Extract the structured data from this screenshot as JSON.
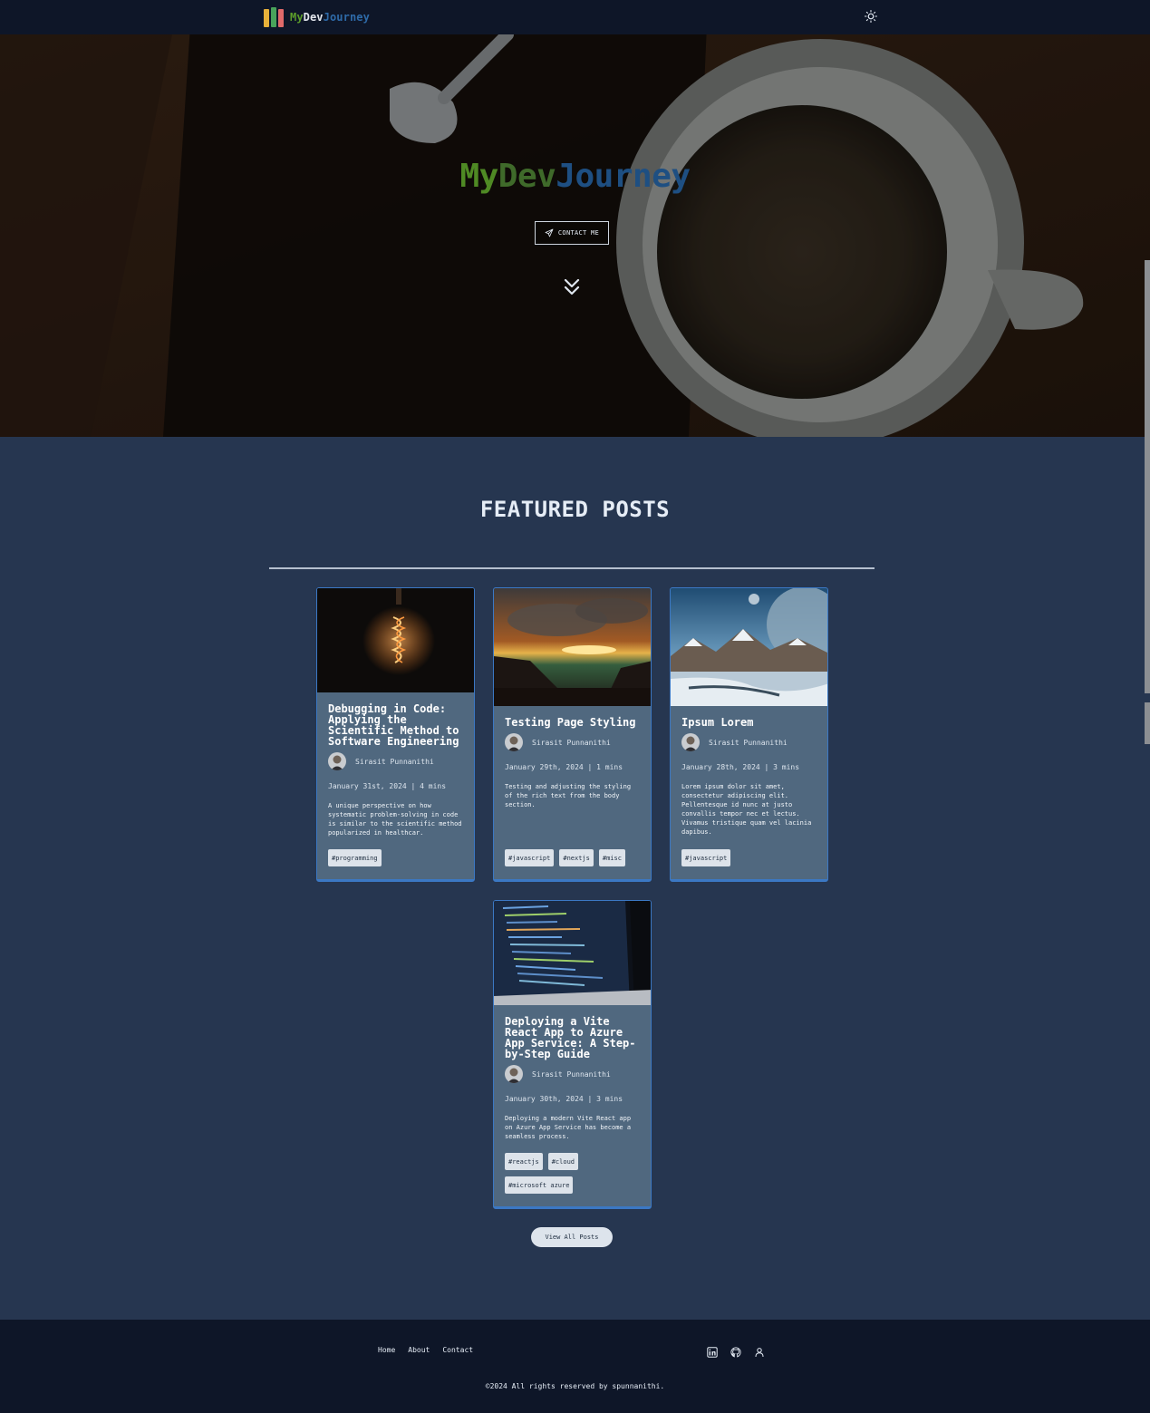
{
  "navbar": {
    "logo": {
      "part1": "My",
      "part2": "Dev",
      "part3": "Journey"
    },
    "theme_icon": "sun-icon"
  },
  "hero": {
    "title": {
      "part1": "My",
      "part2": "Dev",
      "part3": "Journey"
    },
    "contact_label": "CONTACT ME",
    "contact_icon": "paper-plane-icon",
    "scroll_icon": "double-chevron-down-icon"
  },
  "featured": {
    "title": "FEATURED POSTS",
    "posts": [
      {
        "title": "Debugging in Code: Applying the Scientific Method to Software Engineering",
        "author": "Sirasit Punnanithi",
        "meta": "January 31st, 2024 | 4 mins",
        "excerpt": "A unique perspective on how systematic problem-solving in code is similar to the scientific method popularized in healthcar.",
        "tags": [
          "#programming"
        ]
      },
      {
        "title": "Testing Page Styling",
        "author": "Sirasit Punnanithi",
        "meta": "January 29th, 2024 | 1 mins",
        "excerpt": "Testing and adjusting the styling of the rich text from the body section.",
        "tags": [
          "#javascript",
          "#nextjs",
          "#misc"
        ]
      },
      {
        "title": "Ipsum Lorem",
        "author": "Sirasit Punnanithi",
        "meta": "January 28th, 2024 | 3 mins",
        "excerpt": "Lorem ipsum dolor sit amet, consectetur adipiscing elit. Pellentesque id nunc at justo convallis tempor nec et lectus. Vivamus tristique quam vel lacinia dapibus.",
        "tags": [
          "#javascript"
        ]
      },
      {
        "title": "Deploying a Vite React App to Azure App Service: A Step-by-Step Guide",
        "author": "Sirasit Punnanithi",
        "meta": "January 30th, 2024 | 3 mins",
        "excerpt": "Deploying a modern Vite React app on Azure App Service has become a seamless process.",
        "tags": [
          "#reactjs",
          "#cloud",
          "#microsoft azure"
        ]
      }
    ],
    "view_all_label": "View All Posts"
  },
  "footer": {
    "nav": [
      "Home",
      "About",
      "Contact"
    ],
    "icons": [
      "linkedin-icon",
      "github-icon",
      "user-icon"
    ],
    "copyright": "©2024 All rights reserved by spunnanithi."
  },
  "colors": {
    "nav_bg": "#0e1628",
    "page_bg": "#263650",
    "card_bg": "#50687f",
    "card_border": "#3b78c4",
    "logo_green": "#5c9e2a",
    "logo_blue": "#2e6aa8"
  }
}
